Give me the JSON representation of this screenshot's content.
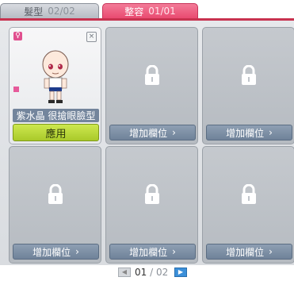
{
  "tabs": [
    {
      "label": "髮型",
      "count": "02/02"
    },
    {
      "label": "整容",
      "count": "01/01"
    }
  ],
  "active_slot": {
    "gender_icon": "♀",
    "close_icon": "×",
    "name": "紫水晶 很搶眼臉型",
    "apply_label": "應用"
  },
  "locked_slot_label": "增加欄位",
  "chevron": "›",
  "pager": {
    "current": "01",
    "separator": "/",
    "total": "02"
  },
  "colors": {
    "accent": "#e94a70",
    "apply": "#b6d63a",
    "locked_button": "#7a8ca3"
  }
}
